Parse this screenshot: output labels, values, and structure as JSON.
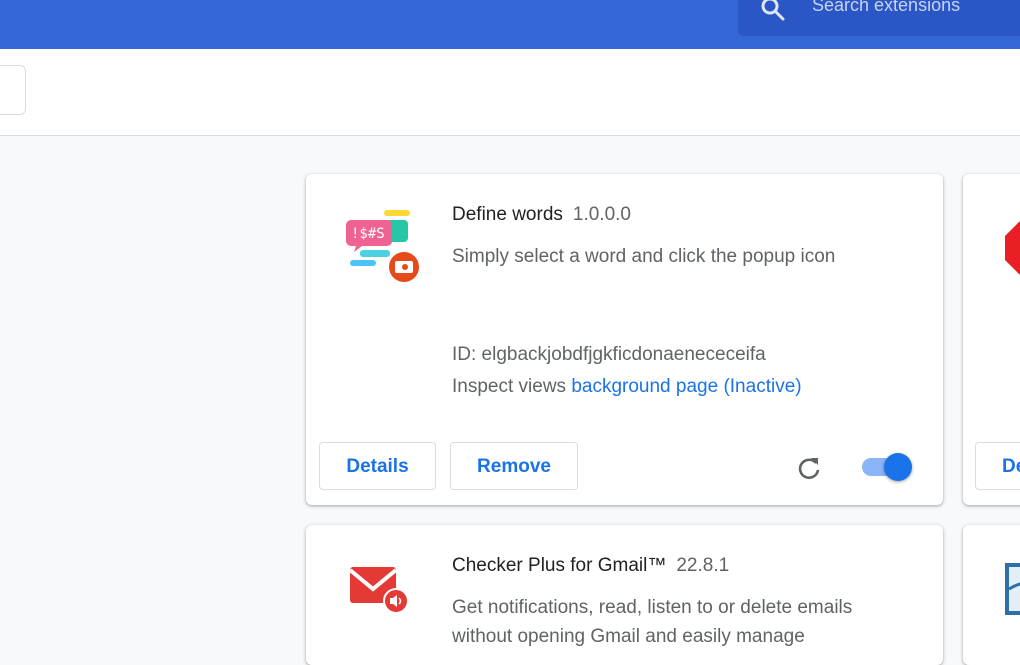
{
  "header": {
    "search_placeholder": "Search extensions"
  },
  "extensions": [
    {
      "name": "Define words",
      "version": "1.0.0.0",
      "description": "Simply select a word and click the popup icon",
      "id_text": "ID: elgbackjobdfjgkficdonaenececeifa",
      "inspect_label": "Inspect views",
      "inspect_link": "background page (Inactive)",
      "details_label": "Details",
      "remove_label": "Remove",
      "enabled": true
    },
    {
      "name": "Checker Plus for Gmail™",
      "version": "22.8.1",
      "description": "Get notifications, read, listen to or delete emails without opening Gmail and easily manage"
    }
  ],
  "partial_card": {
    "details_label_partial": "De"
  },
  "colors": {
    "header": "#3367d6",
    "accent": "#1a73e8",
    "toggle_track": "#8ab4f8"
  }
}
